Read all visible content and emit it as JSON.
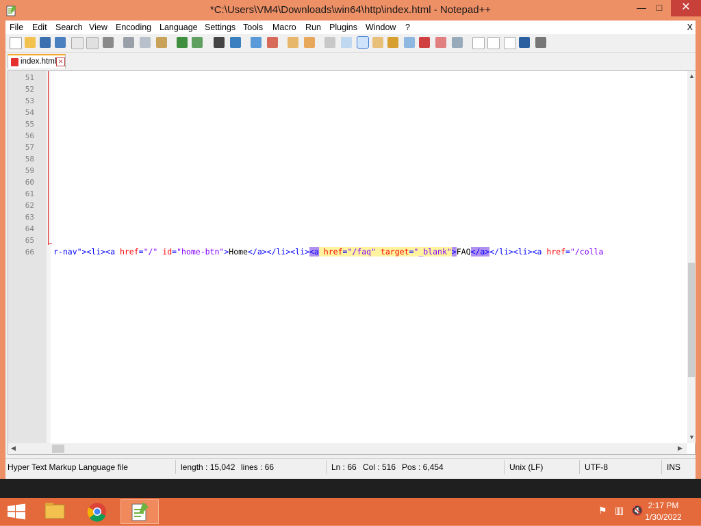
{
  "window": {
    "title": "*C:\\Users\\VM4\\Downloads\\win64\\http\\index.html - Notepad++",
    "minimize": "—",
    "maximize": "□",
    "close": "✕"
  },
  "menu": {
    "items": [
      "File",
      "Edit",
      "Search",
      "View",
      "Encoding",
      "Language",
      "Settings",
      "Tools",
      "Macro",
      "Run",
      "Plugins",
      "Window",
      "?"
    ],
    "close_doc": "X"
  },
  "toolbar": {
    "icons": [
      "new-file-icon",
      "open-file-icon",
      "save-icon",
      "save-all-icon",
      "close-icon",
      "close-all-icon",
      "print-icon",
      "cut-icon",
      "copy-icon",
      "paste-icon",
      "undo-icon",
      "redo-icon",
      "find-icon",
      "replace-icon",
      "zoom-in-icon",
      "zoom-out-icon",
      "sync-vertical-icon",
      "sync-horizontal-icon",
      "word-wrap-icon",
      "show-all-chars-icon",
      "indent-guide-icon",
      "udl-icon",
      "doc-map-icon",
      "function-list-icon",
      "folder-workspace-icon",
      "monitoring-icon",
      "spell-check-icon",
      "record-macro-icon",
      "stop-record-icon",
      "play-macro-icon",
      "run-macro-multiple-icon",
      "save-macro-icon"
    ]
  },
  "tab": {
    "label": "index.html",
    "close": "✕"
  },
  "editor": {
    "line_numbers": [
      "51",
      "52",
      "53",
      "54",
      "55",
      "56",
      "57",
      "58",
      "59",
      "60",
      "61",
      "62",
      "63",
      "64",
      "65",
      "66"
    ],
    "line66": [
      {
        "c": "tag",
        "t": "r-nav\"><li><a "
      },
      {
        "c": "attr",
        "t": "href"
      },
      {
        "c": "tag",
        "t": "="
      },
      {
        "c": "val",
        "t": "\"/\""
      },
      {
        "c": "tag",
        "t": " "
      },
      {
        "c": "attr",
        "t": "id"
      },
      {
        "c": "tag",
        "t": "="
      },
      {
        "c": "val",
        "t": "\"home-btn\""
      },
      {
        "c": "tag",
        "t": ">"
      },
      {
        "c": "txt",
        "t": "Home"
      },
      {
        "c": "tag",
        "t": "</a></li><li>"
      },
      {
        "c": "tag hl",
        "t": "<a"
      },
      {
        "c": "tag ahl",
        "t": " "
      },
      {
        "c": "attr ahl",
        "t": "href"
      },
      {
        "c": "tag ahl",
        "t": "="
      },
      {
        "c": "val ahl",
        "t": "\"/faq\""
      },
      {
        "c": "tag ahl",
        "t": " "
      },
      {
        "c": "attr ahl",
        "t": "target"
      },
      {
        "c": "tag ahl",
        "t": "="
      },
      {
        "c": "val ahl",
        "t": "\"_blank\""
      },
      {
        "c": "tag hl",
        "t": ">"
      },
      {
        "c": "txt",
        "t": "FAQ"
      },
      {
        "c": "tag hl",
        "t": "</a>"
      },
      {
        "c": "tag",
        "t": "</li><li><a "
      },
      {
        "c": "attr",
        "t": "href"
      },
      {
        "c": "tag",
        "t": "="
      },
      {
        "c": "val",
        "t": "\"/colla"
      }
    ]
  },
  "status": {
    "file_type": "Hyper Text Markup Language file",
    "length": "length : 15,042",
    "lines": "lines : 66",
    "ln": "Ln : 66",
    "col": "Col : 516",
    "pos": "Pos : 6,454",
    "eol": "Unix (LF)",
    "encoding": "UTF-8",
    "mode": "INS"
  },
  "taskbar": {
    "time": "2:17 PM",
    "date": "1/30/2022",
    "apps": [
      "file-explorer-icon",
      "chrome-icon",
      "notepadpp-icon"
    ],
    "tray": [
      "flag-icon",
      "network-icon",
      "volume-muted-icon"
    ]
  },
  "colors": {
    "accent": "#ee9066",
    "taskbar": "#e4693b",
    "tag": "#0000ff",
    "attribute": "#ff0000",
    "value": "#8000ff",
    "match_highlight": "#b090f0"
  }
}
